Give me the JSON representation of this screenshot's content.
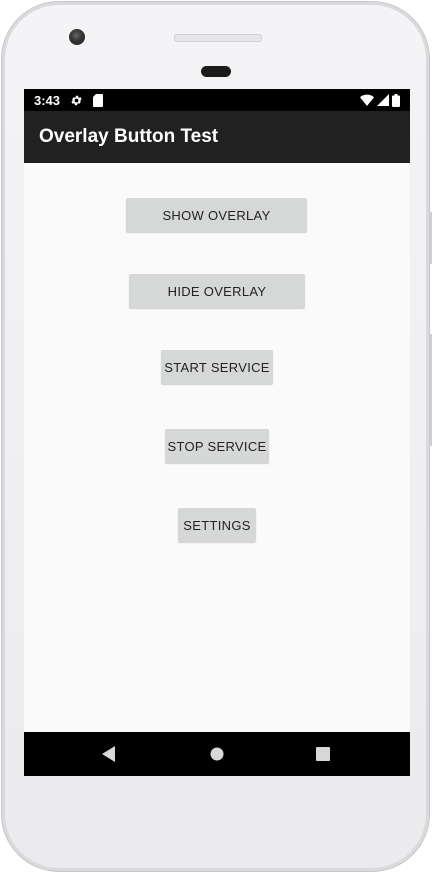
{
  "status_bar": {
    "time": "3:43",
    "icons": [
      "gear-icon",
      "sd-card-icon",
      "wifi-icon",
      "signal-icon",
      "battery-icon"
    ]
  },
  "app_bar": {
    "title": "Overlay Button Test"
  },
  "buttons": {
    "show_overlay": "SHOW OVERLAY",
    "hide_overlay": "HIDE OVERLAY",
    "start_service": "START SERVICE",
    "stop_service": "STOP SERVICE",
    "settings": "SETTINGS"
  },
  "navigation": {
    "icons": [
      "back-icon",
      "home-icon",
      "recents-icon"
    ]
  },
  "colors": {
    "status_bar": "#000000",
    "app_bar": "#212121",
    "screen_background": "#fafafa",
    "button": "#d6d7d7"
  }
}
